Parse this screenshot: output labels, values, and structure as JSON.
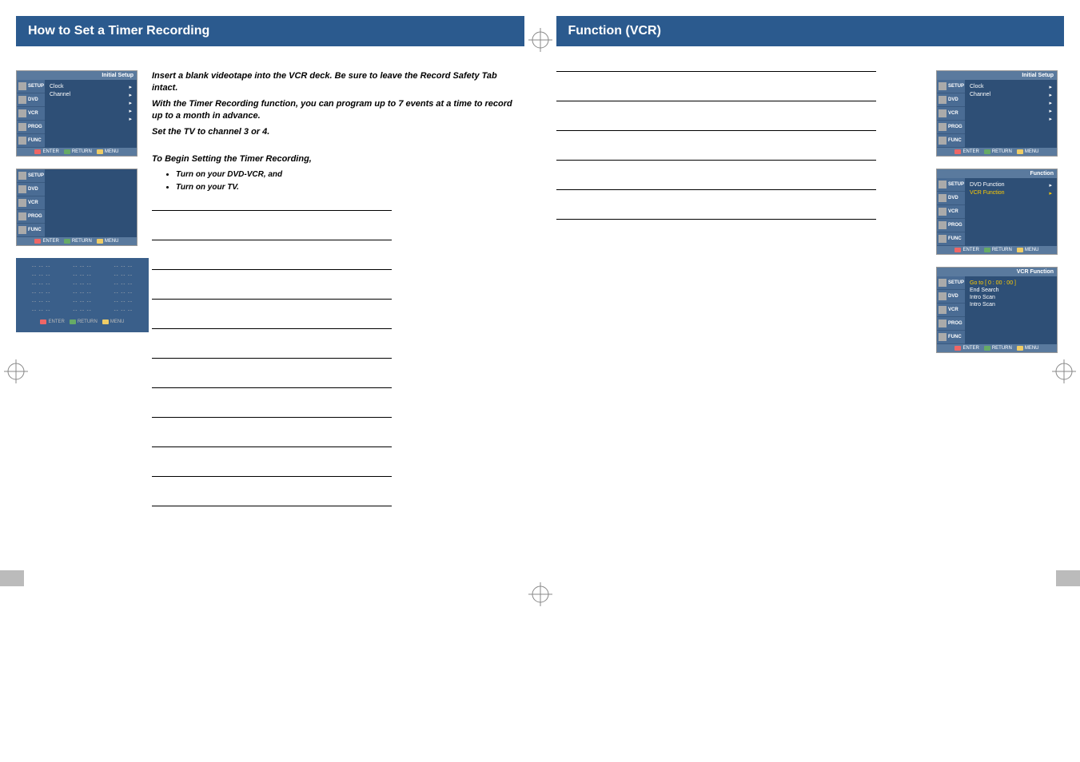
{
  "left": {
    "title": "How to Set a Timer Recording",
    "intro": {
      "line1": "Insert a blank videotape into the VCR deck. Be sure to leave the Record Safety Tab intact.",
      "line2": "With the Timer Recording function, you can program up to 7 events at a time to record up to a month in advance.",
      "line3": "Set the TV to channel 3 or 4.",
      "line4": "To Begin Setting the Timer Recording,",
      "bullet1": "Turn on your DVD-VCR, and",
      "bullet2": "Turn on your TV."
    }
  },
  "right": {
    "title": "Function (VCR)"
  },
  "menu": {
    "header_initial": "Initial Setup",
    "header_function": "Function",
    "header_vcr_function": "VCR Function",
    "tabs": {
      "setup": "SETUP",
      "dvd": "DVD",
      "vcr": "VCR",
      "prog": "PROG",
      "func": "FUNC"
    },
    "initial_items": {
      "clock": "Clock",
      "channel": "Channel"
    },
    "function_items": {
      "dvd_function": "DVD Function",
      "vcr_function": "VCR Function"
    },
    "vcr_func_items": {
      "goto": "Go to [ 0 : 00 : 00 ]",
      "end_search": "End Search",
      "intro_scan1": "Intro Scan",
      "intro_scan2": "Intro Scan"
    },
    "footer": {
      "enter": "ENTER",
      "return": "RETURN",
      "menu": "MENU"
    }
  },
  "prog_cell": "-- -- --"
}
